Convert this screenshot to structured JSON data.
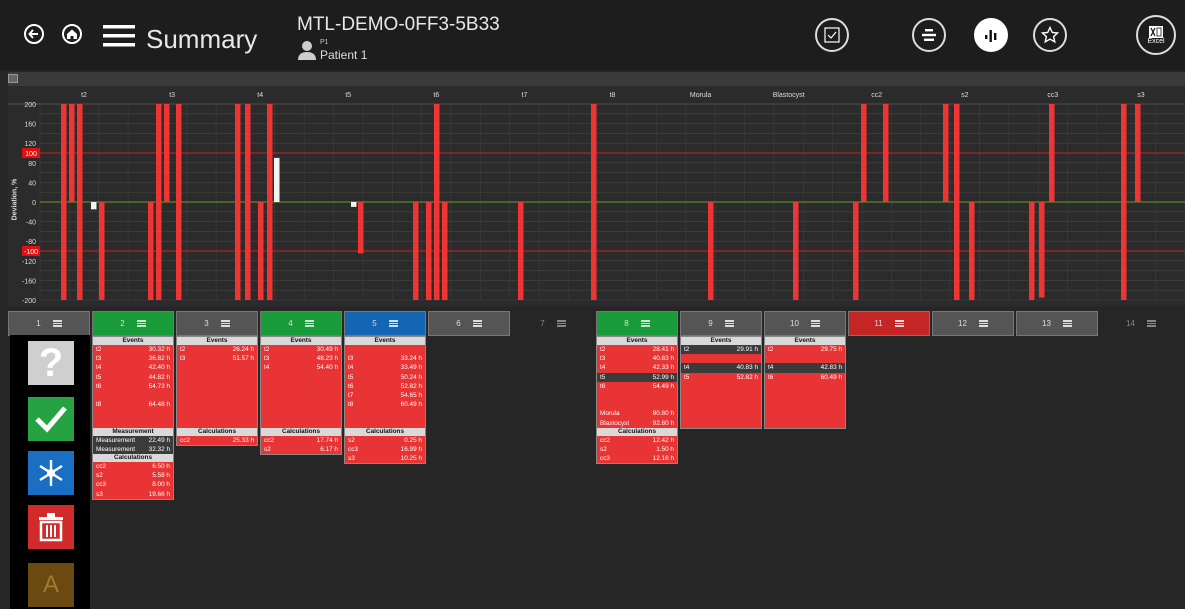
{
  "header": {
    "title": "Summary",
    "dish_id": "MTL-DEMO-0FF3-5B33",
    "well_code": "P1",
    "patient": "Patient 1",
    "excel_label": "Excel"
  },
  "chart_data": {
    "type": "bar",
    "ylabel": "Deviation, %",
    "ylim": [
      -200,
      200
    ],
    "yticks": [
      200,
      160,
      120,
      80,
      40,
      0,
      -40,
      -80,
      -120,
      -160,
      -200
    ],
    "thresholds": [
      100,
      -100
    ],
    "columns": [
      "t2",
      "t3",
      "t4",
      "t5",
      "t6",
      "t7",
      "t8",
      "Morula",
      "Blastocyst",
      "cc2",
      "s2",
      "cc3",
      "s3"
    ],
    "notes": "Per-well deviation bars for each event column; red = outside range, white = within range.",
    "series": [
      {
        "name": "well bars",
        "values": [
          [
            200,
            -200
          ],
          [
            200,
            -200
          ],
          [
            -200
          ],
          [
            -200,
            -200
          ],
          [
            200,
            -200
          ],
          [
            200,
            -200
          ],
          [
            200,
            -200
          ],
          [
            -200
          ],
          [
            -200
          ],
          [
            200,
            -200
          ],
          [
            200,
            -200
          ],
          [
            -200
          ],
          [
            200
          ]
        ]
      }
    ]
  },
  "wells": [
    {
      "label": "1",
      "state": "grey"
    },
    {
      "label": "2",
      "state": "green"
    },
    {
      "label": "3",
      "state": "grey"
    },
    {
      "label": "4",
      "state": "green"
    },
    {
      "label": "5",
      "state": "blue"
    },
    {
      "label": "6",
      "state": "grey"
    },
    {
      "label": "7",
      "state": "dark"
    },
    {
      "label": "8",
      "state": "green"
    },
    {
      "label": "9",
      "state": "grey"
    },
    {
      "label": "10",
      "state": "grey"
    },
    {
      "label": "11",
      "state": "red"
    },
    {
      "label": "12",
      "state": "grey"
    },
    {
      "label": "13",
      "state": "grey"
    },
    {
      "label": "14",
      "state": "dark"
    }
  ],
  "cards": {
    "w2": {
      "events": [
        [
          "t2",
          "30.32 h"
        ],
        [
          "t3",
          "36.82 h"
        ],
        [
          "t4",
          "42.40 h"
        ],
        [
          "t5",
          "44.82 h"
        ],
        [
          "t6",
          "54.73 h"
        ],
        [
          "",
          ""
        ],
        [
          "t8",
          "64.48 h"
        ],
        [
          "",
          ""
        ],
        [
          "",
          ""
        ]
      ],
      "measurement": [
        [
          "Measurement",
          "22.49 h"
        ],
        [
          "Measurement",
          "32.32 h"
        ]
      ],
      "calculations": [
        [
          "cc2",
          "6.50 h"
        ],
        [
          "s2",
          "5.58 h"
        ],
        [
          "cc3",
          "8.00 h"
        ],
        [
          "s3",
          "19.66 h"
        ]
      ]
    },
    "w3": {
      "events": [
        [
          "t2",
          "26.24 h"
        ],
        [
          "t3",
          "51.57 h"
        ]
      ],
      "calculations": [
        [
          "cc2",
          "25.33 h"
        ]
      ]
    },
    "w4": {
      "events": [
        [
          "t2",
          "30.49 h"
        ],
        [
          "t3",
          "48.23 h"
        ],
        [
          "t4",
          "54.40 h"
        ]
      ],
      "calculations": [
        [
          "cc2",
          "17.74 h"
        ],
        [
          "s2",
          "6.17 h"
        ]
      ]
    },
    "w5": {
      "events": [
        [
          "",
          ""
        ],
        [
          "t3",
          "33.24 h"
        ],
        [
          "t4",
          "33.49 h"
        ],
        [
          "t5",
          "50.24 h"
        ],
        [
          "t6",
          "52.82 h"
        ],
        [
          "t7",
          "54.65 h"
        ],
        [
          "t8",
          "60.49 h"
        ]
      ],
      "calculations": [
        [
          "s2",
          "0.25 h"
        ],
        [
          "cc3",
          "16.99 h"
        ],
        [
          "s3",
          "10.25 h"
        ]
      ]
    },
    "w8": {
      "events": [
        [
          "t2",
          "28.41 h"
        ],
        [
          "t3",
          "40.83 h"
        ],
        [
          "t4",
          "42.33 h"
        ],
        [
          "t5",
          "52.99 h"
        ],
        [
          "t6",
          "54.49 h"
        ],
        [
          "",
          ""
        ],
        [
          "",
          ""
        ],
        [
          "Morula",
          "80.80 h"
        ],
        [
          "Blastocyst",
          "92.80 h"
        ]
      ],
      "calculations": [
        [
          "cc2",
          "12.42 h"
        ],
        [
          "s2",
          "1.50 h"
        ],
        [
          "cc3",
          "12.16 h"
        ]
      ]
    },
    "w9": {
      "events": [
        [
          "t2",
          "29.91 h"
        ],
        [
          "",
          ""
        ],
        [
          "t4",
          "40.83 h"
        ],
        [
          "t5",
          "52.82 h"
        ]
      ]
    },
    "w10": {
      "events": [
        [
          "t2",
          "29.75 h"
        ],
        [
          "",
          ""
        ],
        [
          "t4",
          "42.83 h"
        ],
        [
          "t6",
          "60.49 h"
        ]
      ]
    }
  },
  "labels": {
    "events": "Events",
    "measurement": "Measurement",
    "calculations": "Calculations"
  }
}
